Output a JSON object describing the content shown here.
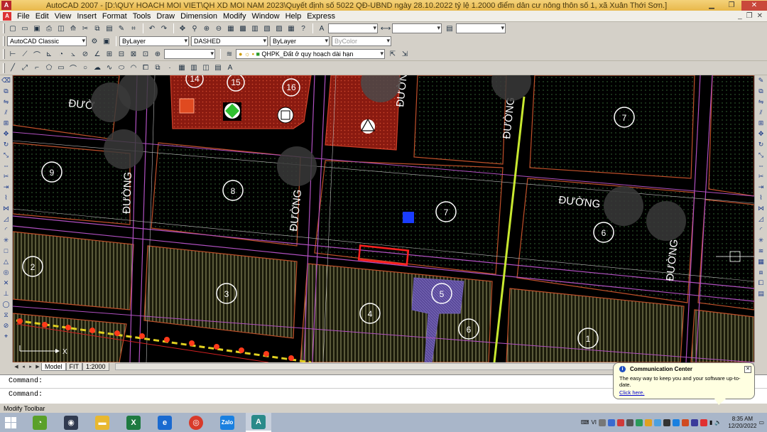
{
  "window": {
    "title": "AutoCAD 2007 - [D:\\QUY HOACH MOI VIET\\QH XD MOI NAM 2023\\Quyết định số 5022 QĐ-UBND ngày 28.10.2022 tỷ lệ 1.2000 điểm dân cư nông thôn số 1, xã Xuân Thới Sơn.]",
    "app_icon": "A"
  },
  "menu": {
    "items": [
      "File",
      "Edit",
      "View",
      "Insert",
      "Format",
      "Tools",
      "Draw",
      "Dimension",
      "Modify",
      "Window",
      "Help",
      "Express"
    ]
  },
  "toolbars": {
    "workspace": "AutoCAD Classic",
    "layer_color": "ByLayer",
    "linetype": "DASHED",
    "lineweight": "ByLayer",
    "plotstyle": "ByColor",
    "current_layer": "QHPK_Đất ở quy hoạch dài hạn"
  },
  "drawing": {
    "street_labels": [
      "ĐƯỜNG",
      "ĐƯỜNG",
      "ĐƯỜNG",
      "ĐƯỜNG",
      "ĐƯỜNG",
      "ĐƯỜNG"
    ],
    "street_labels_partial": [
      "ĐƯỜ",
      "ĐƯỜN"
    ],
    "lot_numbers": [
      "14",
      "15",
      "16",
      "9",
      "8",
      "7",
      "7",
      "6",
      "2",
      "3",
      "4",
      "5",
      "6",
      "1"
    ],
    "ucs_x_label": "X"
  },
  "layout_tabs": {
    "items": [
      "Model",
      "FIT",
      "1:2000"
    ],
    "active": "Model"
  },
  "command": {
    "history": "Command:",
    "prompt": "Command:"
  },
  "status": {
    "text": "Modify Toolbar"
  },
  "balloon": {
    "title": "Communication Center",
    "text": "The easy way to keep you and your software up-to-date.",
    "link": "Click here."
  },
  "taskbar": {
    "apps": [
      "windows-start",
      "file-explorer",
      "excel",
      "edge",
      "chrome",
      "zalo",
      "autocad"
    ],
    "tray_lang": "VI",
    "time": "8:35 AM",
    "date": "12/20/2022"
  }
}
